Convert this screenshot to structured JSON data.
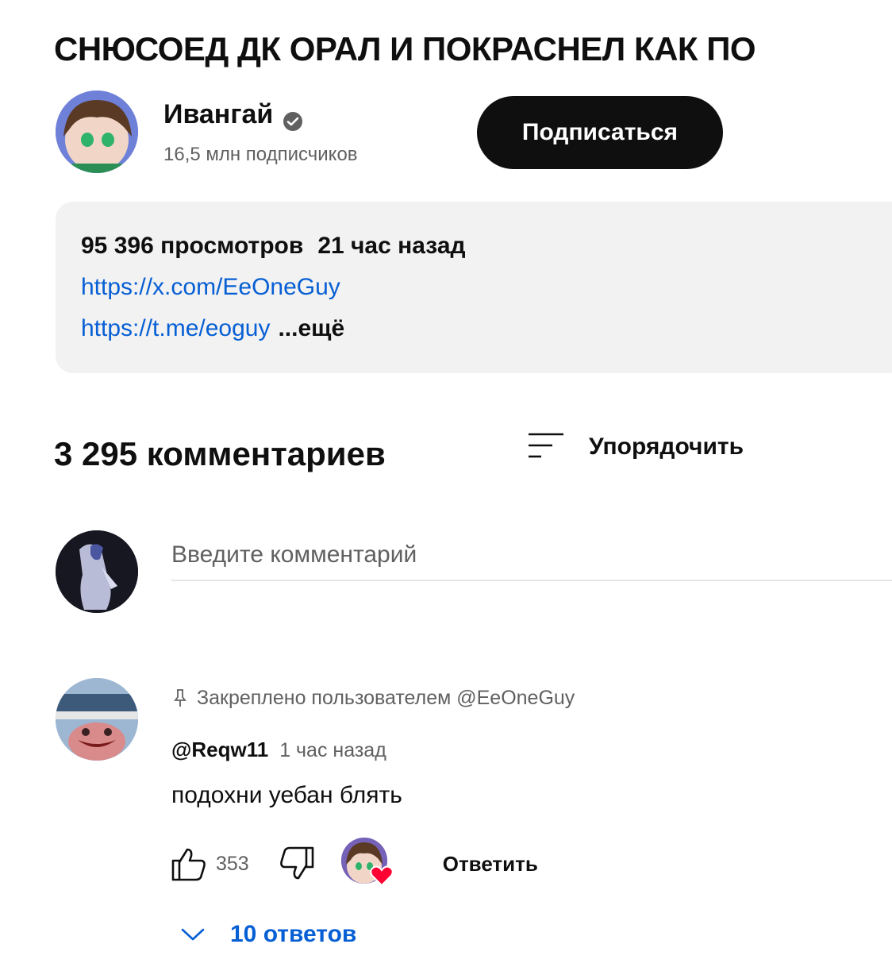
{
  "video": {
    "title": "СНЮСОЕД ДК ОРАЛ И ПОКРАСНЕЛ КАК ПО"
  },
  "channel": {
    "name": "Ивангай",
    "subscribers": "16,5 млн подписчиков",
    "subscribe_label": "Подписаться",
    "verified_icon": "verified-check-icon"
  },
  "description": {
    "views": "95 396 просмотров",
    "published": "21 час назад",
    "links": [
      "https://x.com/EeOneGuy",
      "https://t.me/eoguy"
    ],
    "more_label": "...ещё"
  },
  "comments": {
    "count_label": "3 295 комментариев",
    "sort_label": "Упорядочить",
    "input_placeholder": "Введите комментарий",
    "items": [
      {
        "pinned_label": "Закреплено пользователем @EeOneGuy",
        "author": "@Reqw11",
        "time": "1 час назад",
        "text": "подохни уебан блять",
        "likes": "353",
        "reply_label": "Ответить",
        "replies_label": "10 ответов"
      }
    ]
  },
  "colors": {
    "link": "#065fd4",
    "subscribe_bg": "#0f0f0f",
    "description_bg": "#f2f2f2",
    "secondary_text": "#606060",
    "heart": "#ff0033"
  }
}
